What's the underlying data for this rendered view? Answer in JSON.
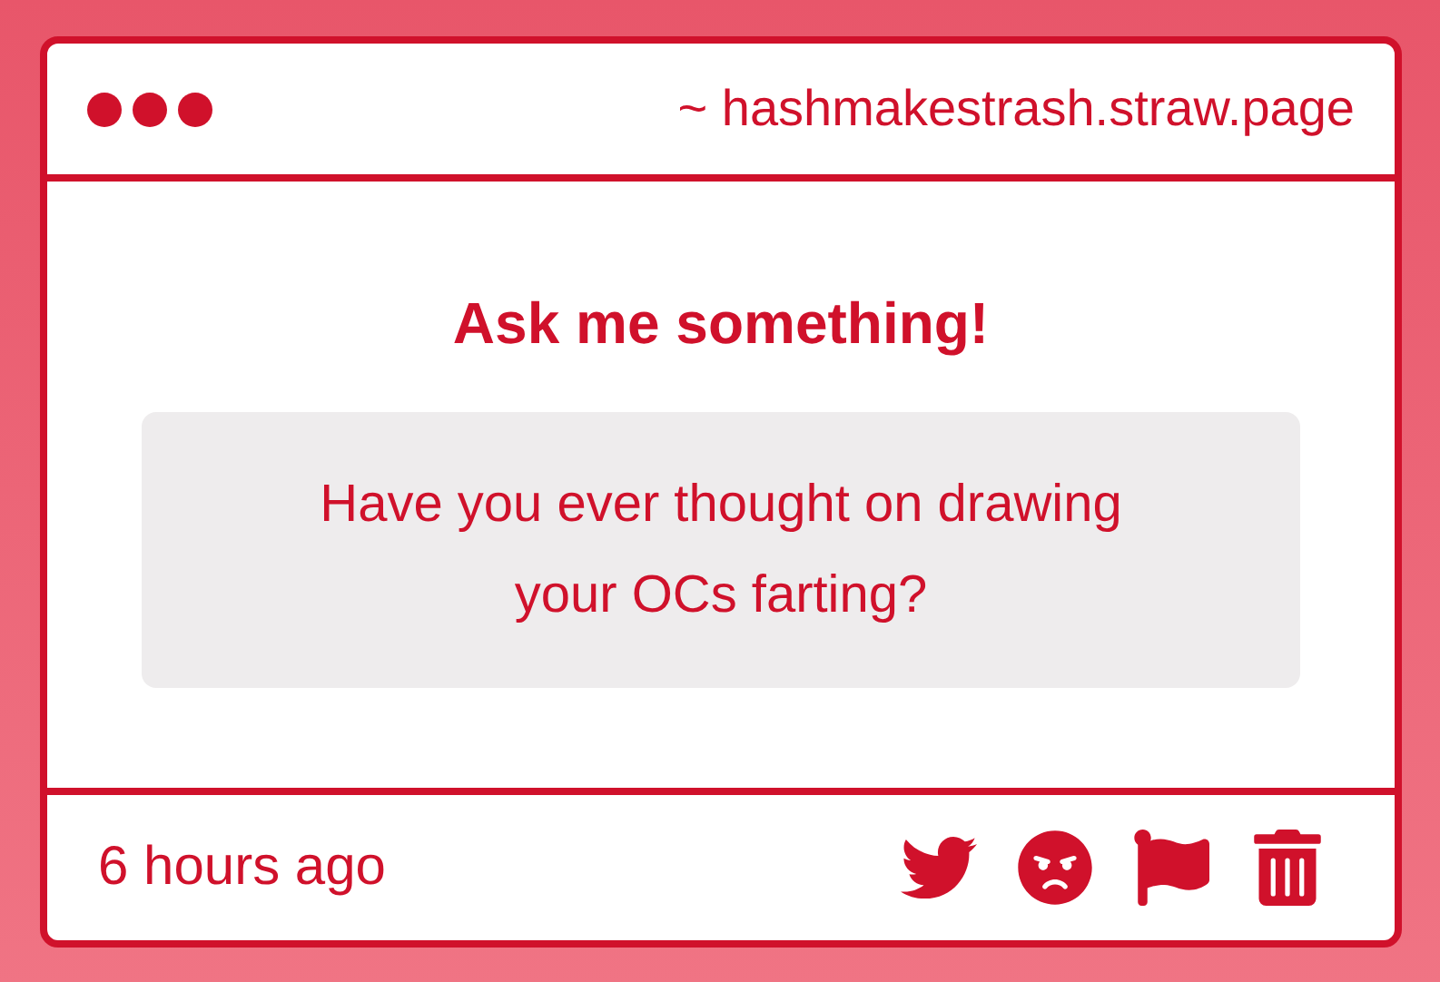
{
  "window": {
    "url": "~ hashmakestrash.straw.page",
    "dots": [
      {
        "kind": "dot"
      },
      {
        "kind": "dot"
      },
      {
        "kind": "dot"
      }
    ]
  },
  "prompt": {
    "title": "Ask me something!",
    "question": "Have you ever thought on drawing your OCs farting?"
  },
  "footer": {
    "time": "6 hours ago",
    "actions": [
      {
        "kind": "twitter"
      },
      {
        "kind": "angry"
      },
      {
        "kind": "flag"
      },
      {
        "kind": "trash"
      }
    ]
  }
}
